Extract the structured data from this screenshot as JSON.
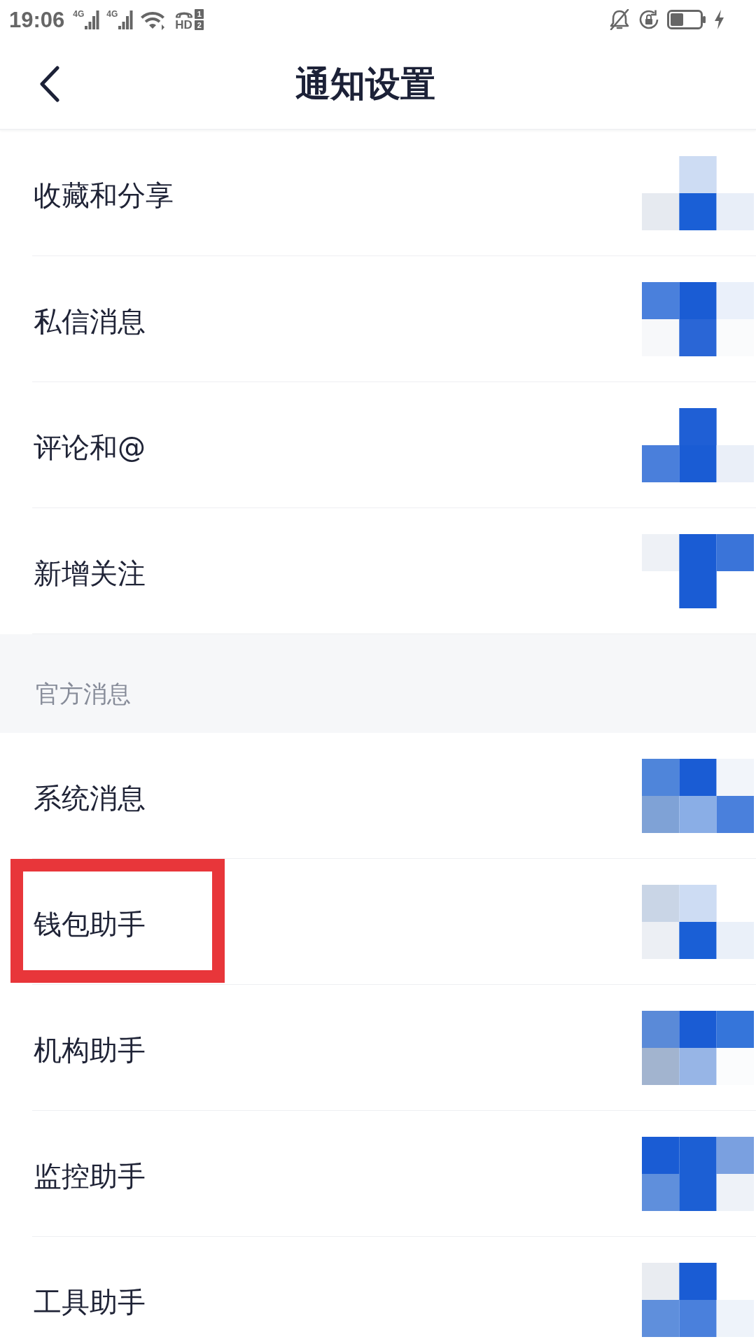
{
  "status_bar": {
    "time": "19:06",
    "signals": [
      {
        "network": "4G"
      },
      {
        "network": "4G"
      }
    ],
    "call_badge": {
      "label": "HD",
      "slots": [
        "1",
        "2"
      ]
    }
  },
  "header": {
    "title": "通知设置"
  },
  "sections": [
    {
      "rows": [
        {
          "label": "收藏和分享",
          "highlighted": false
        },
        {
          "label": "私信消息",
          "highlighted": false
        },
        {
          "label": "评论和@",
          "highlighted": false
        },
        {
          "label": "新增关注",
          "highlighted": false
        }
      ]
    },
    {
      "title": "官方消息",
      "rows": [
        {
          "label": "系统消息",
          "highlighted": false
        },
        {
          "label": "钱包助手",
          "highlighted": true
        },
        {
          "label": "机构助手",
          "highlighted": false
        },
        {
          "label": "监控助手",
          "highlighted": false
        },
        {
          "label": "工具助手",
          "highlighted": false
        }
      ]
    }
  ]
}
